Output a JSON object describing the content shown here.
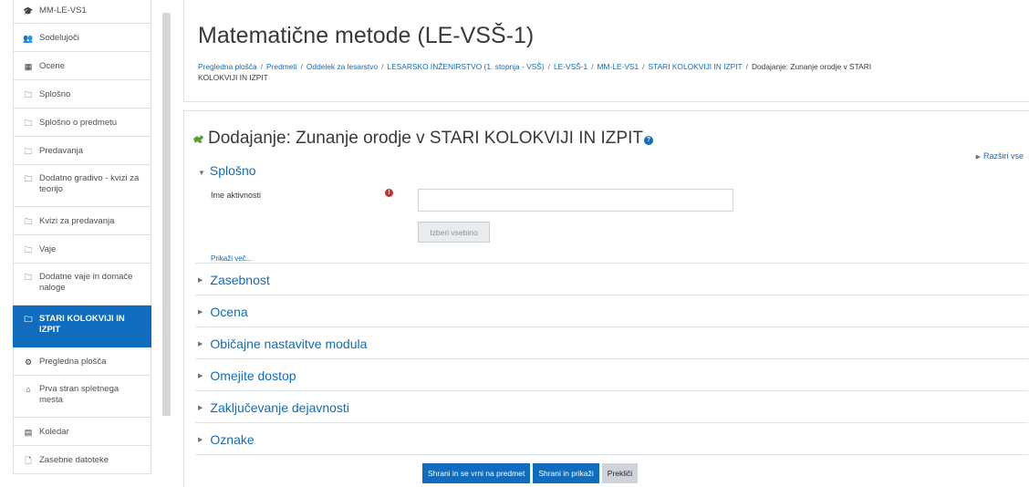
{
  "sidebar": {
    "items": [
      {
        "label": "MM-LE-VS1",
        "icon": "graduation-cap-icon",
        "glyph": "🎓"
      },
      {
        "label": "Sodelujoči",
        "icon": "users-icon",
        "glyph": "👥"
      },
      {
        "label": "Ocene",
        "icon": "table-icon",
        "glyph": "▦"
      },
      {
        "label": "Splošno",
        "icon": "folder-icon",
        "glyph": "🗀"
      },
      {
        "label": "Splošno o predmetu",
        "icon": "folder-icon",
        "glyph": "🗀"
      },
      {
        "label": "Predavanja",
        "icon": "folder-icon",
        "glyph": "🗀"
      },
      {
        "label": "Dodatno gradivo - kvizi za teorijo",
        "icon": "folder-icon",
        "glyph": "🗀"
      },
      {
        "label": "Kvizi za predavanja",
        "icon": "folder-icon",
        "glyph": "🗀"
      },
      {
        "label": "Vaje",
        "icon": "folder-icon",
        "glyph": "🗀"
      },
      {
        "label": "Dodatne vaje in domače naloge",
        "icon": "folder-icon",
        "glyph": "🗀"
      },
      {
        "label": "STARI KOLOKVIJI IN IZPIT",
        "icon": "folder-icon",
        "glyph": "🗀",
        "active": true
      },
      {
        "label": "Pregledna plošča",
        "icon": "dashboard-icon",
        "glyph": "⚙"
      },
      {
        "label": "Prva stran spletnega mesta",
        "icon": "home-icon",
        "glyph": "⌂"
      },
      {
        "label": "Koledar",
        "icon": "calendar-icon",
        "glyph": "▤"
      },
      {
        "label": "Zasebne datoteke",
        "icon": "file-icon",
        "glyph": "🗋"
      }
    ]
  },
  "header": {
    "title": "Matematične metode (LE-VSŠ-1)",
    "breadcrumb": [
      "Pregledna plošča",
      "Predmeti",
      "Oddelek za lesarstvo",
      "LESARSKO INŽENIRSTVO (1. stopnja - VSŠ)",
      "LE-VSŠ-1",
      "MM-LE-VS1",
      "STARI KOLOKVIJI IN IZPIT"
    ],
    "breadcrumb_current": "Dodajanje: Zunanje orodje v STARI KOLOKVIJI IN IZPIT"
  },
  "main": {
    "heading": "Dodajanje: Zunanje orodje v STARI KOLOKVIJI IN IZPIT",
    "expand_all": "Razširi vse",
    "general": {
      "legend": "Splošno",
      "activity_name_label": "Ime aktivnosti",
      "activity_name_value": "",
      "select_content_button": "Izberi vsebino",
      "show_more": "Prikaži več..."
    },
    "sections": [
      "Zasebnost",
      "Ocena",
      "Običajne nastavitve modula",
      "Omejite dostop",
      "Zaključevanje dejavnosti",
      "Oznake"
    ],
    "buttons": {
      "save_return": "Shrani in se vrni na predmet",
      "save_display": "Shrani in prikaži",
      "cancel": "Prekliči"
    }
  },
  "colors": {
    "primary": "#0f6cbf",
    "required": "#c9302c",
    "border": "#dee2e6"
  }
}
